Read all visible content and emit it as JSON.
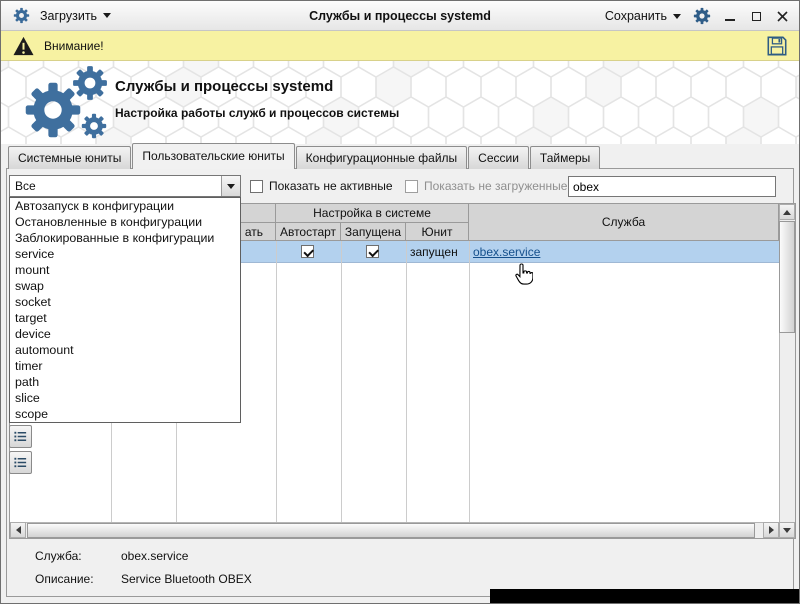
{
  "titlebar": {
    "load_label": "Загрузить",
    "title": "Службы и процессы systemd",
    "save_label": "Сохранить"
  },
  "warning_bar": {
    "message": "Внимание!"
  },
  "hero": {
    "title": "Службы и процессы systemd",
    "subtitle": "Настройка работы служб и процессов системы"
  },
  "tabs": [
    {
      "label": "Системные юниты"
    },
    {
      "label": "Пользовательские юниты"
    },
    {
      "label": "Конфигурационные файлы"
    },
    {
      "label": "Сессии"
    },
    {
      "label": "Таймеры"
    }
  ],
  "filters": {
    "unit_filter_value": "Все",
    "show_inactive_label": "Показать не активные",
    "show_unloaded_label": "Показать не загруженные",
    "search_value": "obex"
  },
  "filter_dropdown": {
    "items": [
      "Автозапуск в конфигурации",
      "Остановленные в конфигурации",
      "Заблокированные в конфигурации",
      "service",
      "mount",
      "swap",
      "socket",
      "target",
      "device",
      "automount",
      "timer",
      "path",
      "slice",
      "scope"
    ]
  },
  "table": {
    "group_header": "Настройка в системе",
    "col_partial": "ать",
    "col_autostart": "Автостарт",
    "col_running": "Запущена",
    "col_unit": "Юнит",
    "col_service": "Служба",
    "selected_row": {
      "autostart_checked": true,
      "running_checked": true,
      "unit_state": "запущен",
      "service_link": "obex.service"
    }
  },
  "details": {
    "service_label": "Служба:",
    "service_value": "obex.service",
    "description_label": "Описание:",
    "description_value": "Service Bluetooth OBEX"
  },
  "colors": {
    "selection": "#b3d1ee",
    "link": "#15508c",
    "warning_bg": "#f7f2a2",
    "accent_blue": "#3f6f9e"
  }
}
